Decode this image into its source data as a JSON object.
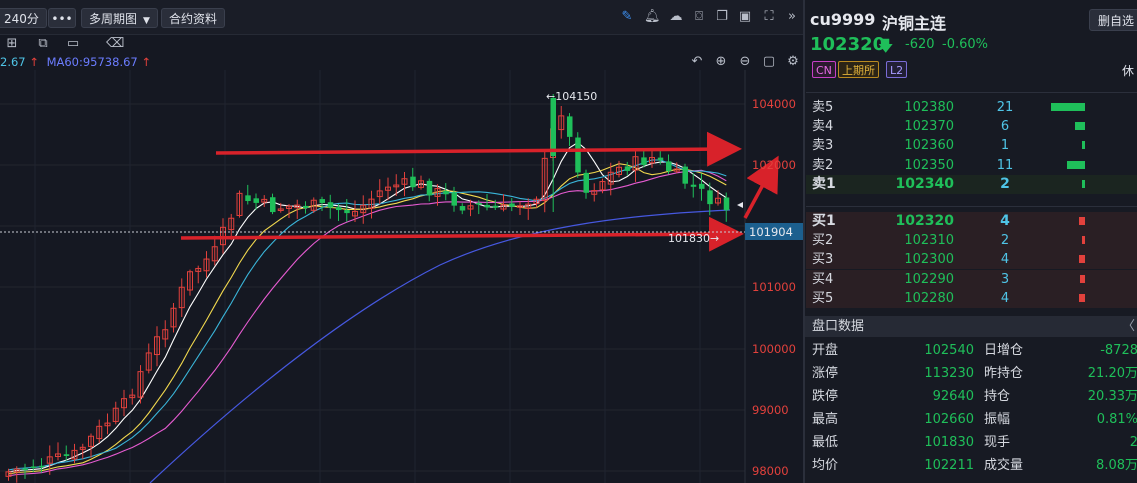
{
  "toolbar": {
    "period_label": "240分",
    "more_label": "•••",
    "multi_period_label": "多周期图",
    "contract_label": "合约资料"
  },
  "indicators": {
    "ma_prev": "2.67",
    "ma60": "MA60:95738.67"
  },
  "chart": {
    "y_ticks": [
      "104000",
      "102000",
      "101000",
      "100000",
      "99000",
      "98000"
    ],
    "high_label": "←104150",
    "low_label": "101830→",
    "current_price_label": "101904",
    "colors": {
      "up": "#e2413c",
      "down": "#1fbf5a",
      "arrow": "#d8222a",
      "ma5": "#ffffff",
      "ma10": "#f2d94e",
      "ma20": "#e65bd1",
      "ma30": "#3ab5d9",
      "ma60": "#4658e0"
    }
  },
  "symbol": {
    "code": "cu9999",
    "name": "沪铜主连",
    "add_button": "删自选",
    "price": "102320",
    "change": "-620",
    "change_pct": "-0.60%",
    "tags": [
      "CN",
      "上期所",
      "L2"
    ],
    "status": "休"
  },
  "order_book": {
    "asks": [
      {
        "label": "卖5",
        "price": "102380",
        "vol": "21",
        "level": 1.0
      },
      {
        "label": "卖4",
        "price": "102370",
        "vol": "6",
        "level": 0.29
      },
      {
        "label": "卖3",
        "price": "102360",
        "vol": "1",
        "level": 0.05
      },
      {
        "label": "卖2",
        "price": "102350",
        "vol": "11",
        "level": 0.52
      },
      {
        "label": "卖1",
        "price": "102340",
        "vol": "2",
        "level": 0.1
      }
    ],
    "bids": [
      {
        "label": "买1",
        "price": "102320",
        "vol": "4",
        "level": 0.19
      },
      {
        "label": "买2",
        "price": "102310",
        "vol": "2",
        "level": 0.1
      },
      {
        "label": "买3",
        "price": "102300",
        "vol": "4",
        "level": 0.19
      },
      {
        "label": "买4",
        "price": "102290",
        "vol": "3",
        "level": 0.14
      },
      {
        "label": "买5",
        "price": "102280",
        "vol": "4",
        "level": 0.19
      }
    ]
  },
  "stats": {
    "title": "盘口数据",
    "rows": [
      {
        "l1": "开盘",
        "v1": "102540",
        "l2": "日增仓",
        "v2": "-8728"
      },
      {
        "l1": "涨停",
        "v1": "113230",
        "l2": "昨持仓",
        "v2": "21.20万"
      },
      {
        "l1": "跌停",
        "v1": "92640",
        "l2": "持仓",
        "v2": "20.33万"
      },
      {
        "l1": "最高",
        "v1": "102660",
        "l2": "振幅",
        "v2": "0.81%"
      },
      {
        "l1": "最低",
        "v1": "101830",
        "l2": "现手",
        "v2": "2"
      },
      {
        "l1": "均价",
        "v1": "102211",
        "l2": "成交量",
        "v2": "8.08万"
      }
    ]
  }
}
